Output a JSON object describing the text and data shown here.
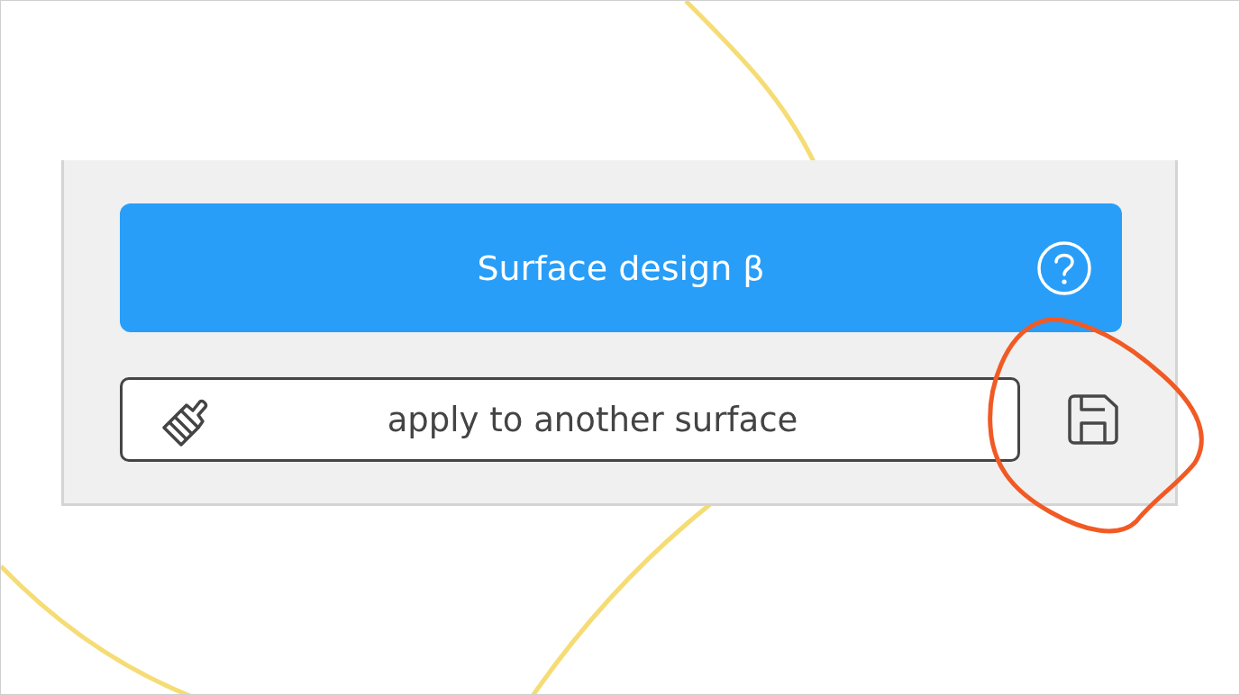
{
  "panel": {
    "title_button": {
      "label": "Surface design β"
    },
    "apply_button": {
      "label": "apply to another surface"
    }
  }
}
